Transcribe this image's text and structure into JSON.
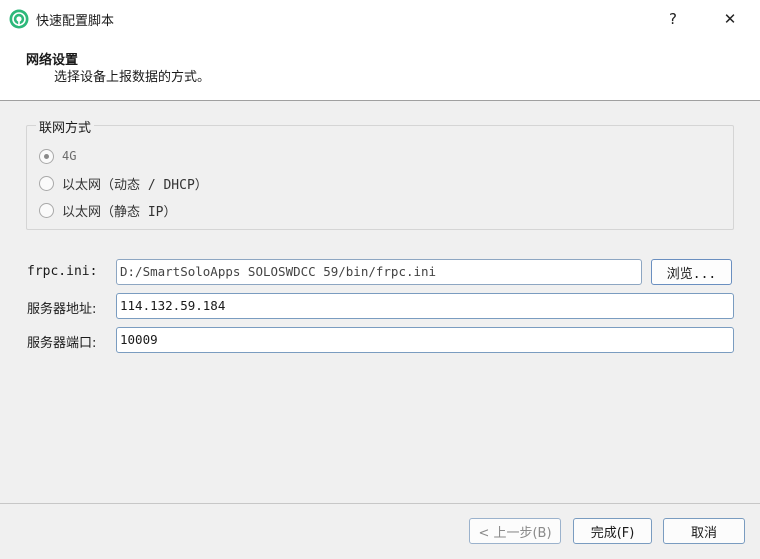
{
  "window": {
    "title": "快速配置脚本",
    "help": "?",
    "close": "✕"
  },
  "header": {
    "title": "网络设置",
    "subtitle": "选择设备上报数据的方式。"
  },
  "network": {
    "group_label": "联网方式",
    "options": [
      {
        "label": "4G",
        "selected": true
      },
      {
        "label": "以太网（动态 / DHCP）",
        "selected": false
      },
      {
        "label": "以太网（静态 IP）",
        "selected": false
      }
    ]
  },
  "form": {
    "frpc_label": "frpc.ini:",
    "frpc_value": "D:/SmartSoloApps SOLOSWDCC 59/bin/frpc.ini",
    "browse_label": "浏览...",
    "server_label": "服务器地址:",
    "server_value": "114.132.59.184",
    "port_label": "服务器端口:",
    "port_value": "10009"
  },
  "footer": {
    "back_label": "< 上一步(B)",
    "finish_label": "完成(F)",
    "cancel_label": "取消"
  },
  "colors": {
    "accent": "#7a9cc0",
    "icon_green": "#2db87a"
  }
}
